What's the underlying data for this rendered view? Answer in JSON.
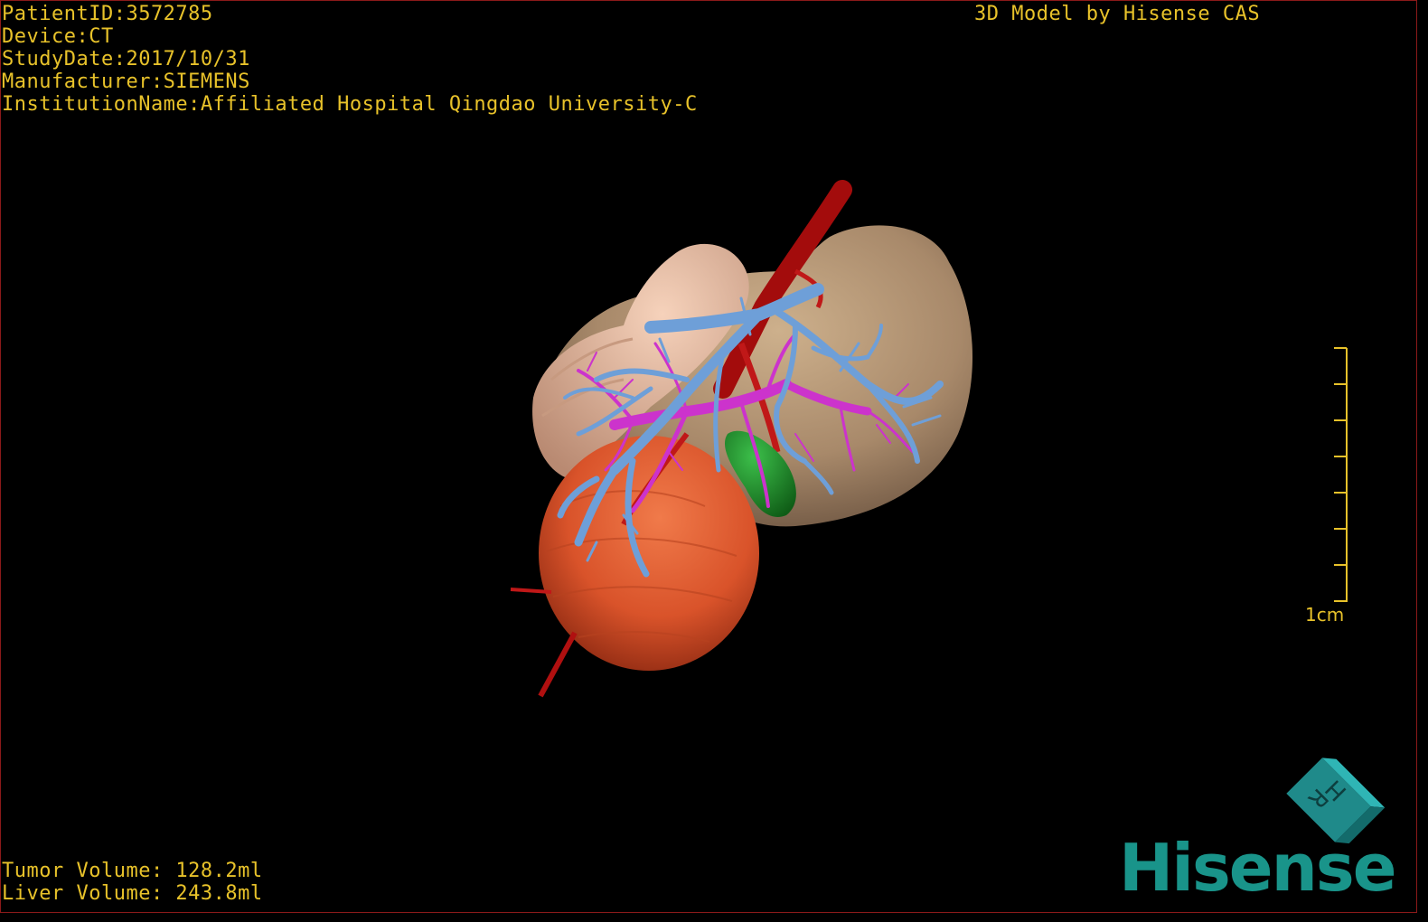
{
  "patient_info": {
    "patient_id": "PatientID:3572785",
    "device": "Device:CT",
    "study_date": "StudyDate:2017/10/31",
    "manufacturer": "Manufacturer:SIEMENS",
    "institution": "InstitutionName:Affiliated Hospital Qingdao University-C"
  },
  "brand_text": "3D Model by Hisense CAS",
  "volumes": {
    "tumor": "Tumor Volume: 128.2ml",
    "liver": "Liver Volume: 243.8ml"
  },
  "scale_bar": {
    "label": "1cm",
    "ticks": 8
  },
  "orientation_cube": {
    "letters": [
      "H",
      "R"
    ]
  },
  "logo": {
    "wordmark": "Hisense"
  },
  "colors": {
    "overlay_text": "#e8c22a",
    "liver": "#a88a6b",
    "caudate": "#e2b499",
    "tumor": "#d9532a",
    "hepatic_vein": "#6e9fd8",
    "portal_vein": "#cc33cc",
    "artery": "#b01010",
    "gallbladder": "#1f8a2a",
    "logo": "#19948a"
  }
}
